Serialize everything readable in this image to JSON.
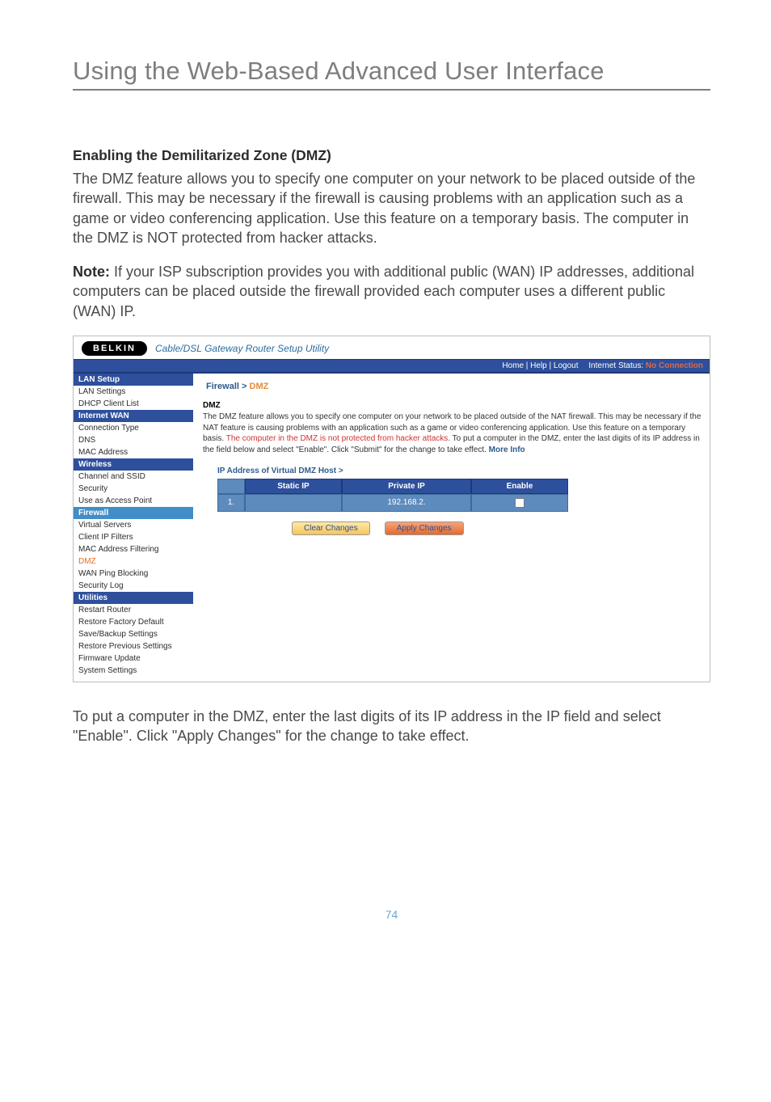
{
  "page": {
    "title": "Using the Web-Based Advanced User Interface",
    "section_heading": "Enabling the Demilitarized Zone (DMZ)",
    "para1": "The DMZ feature allows you to specify one computer on your network to be placed outside of the firewall. This may be necessary if the firewall is causing problems with an application such as a game or video conferencing application. Use this feature on a temporary basis. The computer in the DMZ is NOT protected from hacker attacks.",
    "note_label": "Note:",
    "note_body": " If your ISP subscription provides you with additional public (WAN) IP addresses, additional computers can be placed outside the firewall provided each computer uses a different public (WAN) IP.",
    "para_after": "To put a computer in the DMZ, enter the last digits of its IP address in the IP field and select \"Enable\". Click \"Apply Changes\" for the change to take effect.",
    "page_number": "74"
  },
  "shot": {
    "logo": "BELKIN",
    "tagline": "Cable/DSL Gateway Router Setup Utility",
    "topbar": {
      "home": "Home",
      "help": "Help",
      "logout": "Logout",
      "status_label": "Internet Status:",
      "status_value": "No Connection"
    },
    "sidebar": {
      "groups": [
        {
          "head": "LAN Setup",
          "items": [
            "LAN Settings",
            "DHCP Client List"
          ]
        },
        {
          "head": "Internet WAN",
          "items": [
            "Connection Type",
            "DNS",
            "MAC Address"
          ]
        },
        {
          "head": "Wireless",
          "items": [
            "Channel and SSID",
            "Security",
            "Use as Access Point"
          ]
        }
      ],
      "firewall_head": "Firewall",
      "firewall_items": [
        "Virtual Servers",
        "Client IP Filters",
        "MAC Address Filtering",
        "DMZ",
        "WAN Ping Blocking",
        "Security Log"
      ],
      "utilities_head": "Utilities",
      "utilities_items": [
        "Restart Router",
        "Restore Factory Default",
        "Save/Backup Settings",
        "Restore Previous Settings",
        "Firmware Update",
        "System Settings"
      ]
    },
    "content": {
      "crumb_a": "Firewall > ",
      "crumb_b": "DMZ",
      "sec_label": "DMZ",
      "desc_a": "The DMZ feature allows you to specify one computer on your network to be placed outside of the NAT firewall. This may be necessary if the NAT feature is causing problems with an application such as a game or video conferencing application. Use this feature on a temporary basis. ",
      "desc_red": "The computer in the DMZ is not protected from hacker attacks.",
      "desc_b": " To put a computer in the DMZ, enter the last digits of its IP address in the field below and select \"Enable\". Click \"Submit\" for the change to take effect. ",
      "more": "More Info",
      "subhead": "IP Address of Virtual DMZ Host >",
      "th_static": "Static IP",
      "th_private": "Private IP",
      "th_enable": "Enable",
      "row_index": "1.",
      "row_private": "192.168.2.",
      "btn_clear": "Clear Changes",
      "btn_apply": "Apply Changes"
    }
  }
}
